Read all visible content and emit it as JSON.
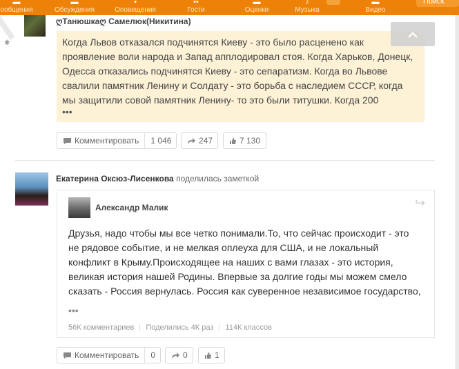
{
  "nav": {
    "items": [
      {
        "label": "ообщения",
        "icon": "messages-icon"
      },
      {
        "label": "Обсуждения",
        "icon": "discussions-icon"
      },
      {
        "label": "Оповещения",
        "icon": "notifications-icon"
      },
      {
        "label": "Гости",
        "icon": "guests-icon"
      },
      {
        "label": "Оценки",
        "icon": "ratings-icon"
      },
      {
        "label": "Музыка",
        "icon": "music-icon"
      },
      {
        "label": "Видео",
        "icon": "video-icon"
      }
    ],
    "search_label": "Поиск"
  },
  "post1": {
    "author": "ღТанюшкаღ Самелюк(Никитина)",
    "text": "Когда Львов отказался подчинятся Киеву - это было расценено как\nпроявление воли народа и Запад апплодировал стоя. Когда Харьков, Донецк,\n Одесса отказались подчинятся Киеву - это сепаратизм. Когда во Львове\nсвалили памятник Ленину и Солдату - это борьба с наследием СССР, когда\nмы защитили совой памятник Ленину- то это были титушки. Когда 200",
    "more": "•••",
    "comment_label": "Комментировать",
    "comment_count": "1 046",
    "reshare_count": "247",
    "like_count": "7 130"
  },
  "post2": {
    "sharer": "Екатерина Оксюз-Лисенкова",
    "share_action": "поделилась заметкой",
    "card": {
      "author": "Александр Малик",
      "text": "Друзья, надо чтобы мы все четко понимали.То, что сейчас происходит - это\nне рядовое событие, и не мелкая оплеуха для США, и не локальный\nконфликт в Крыму.Происходящее на наших с вами глазах - это история,\nвеликая история нашей Родины. Впервые за долгие годы мы можем смело\nсказать - Россия вернулась. Россия как суверенное независимое государство,",
      "more": "•••",
      "stats": {
        "comments": "56К комментариев",
        "shares": "Поделились 4К раз",
        "likes": "114К классов"
      }
    },
    "comment_label": "Комментировать",
    "comment_count": "0",
    "reshare_count": "0",
    "like_count": "1"
  },
  "colors": {
    "topbar": "#ee8208",
    "quote_bg": "#fdf1d6"
  }
}
